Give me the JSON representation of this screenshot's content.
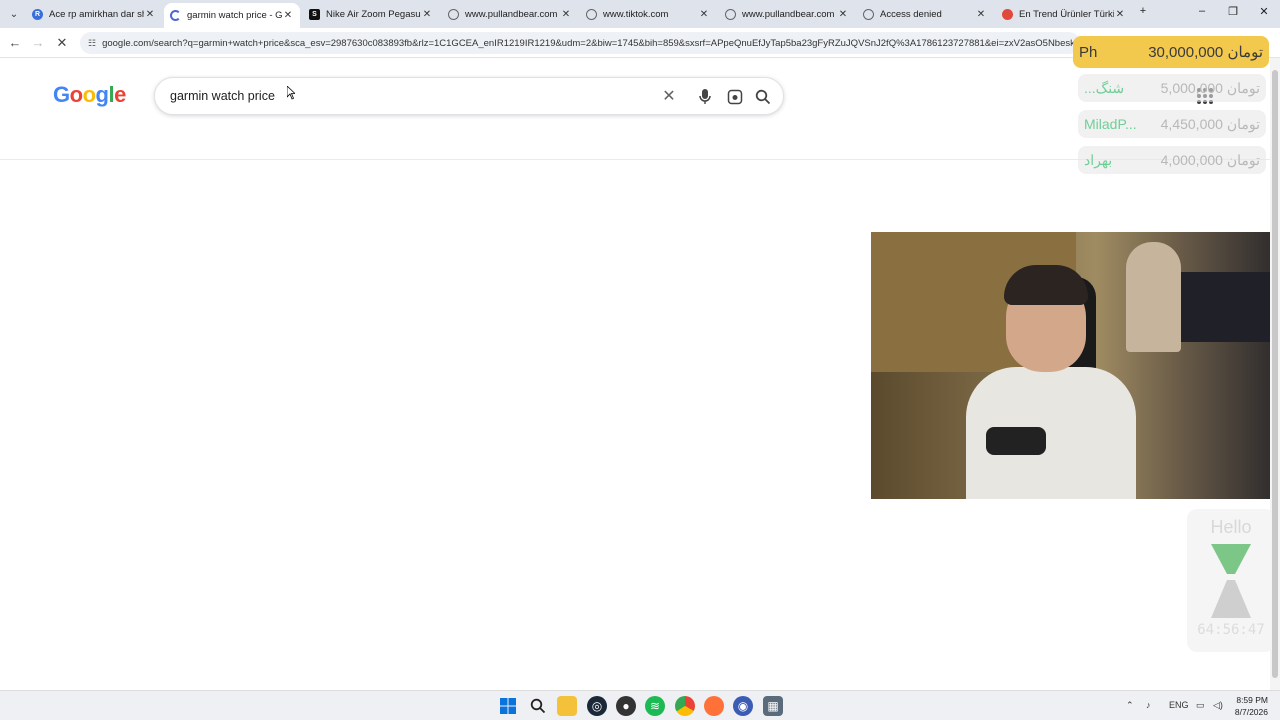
{
  "browser": {
    "tabs": [
      {
        "title": "Ace rp amirkhan dar shah",
        "favicon": "blue-circle-icon",
        "active": false
      },
      {
        "title": "garmin watch price - Goo",
        "favicon": "loading-icon",
        "active": true
      },
      {
        "title": "Nike Air Zoom Pegasus 3",
        "favicon": "s-square-icon",
        "active": false
      },
      {
        "title": "www.pullandbear.com",
        "favicon": "globe-icon",
        "active": false
      },
      {
        "title": "www.tiktok.com",
        "favicon": "globe-icon",
        "active": false
      },
      {
        "title": "www.pullandbear.com",
        "favicon": "globe-icon",
        "active": false
      },
      {
        "title": "Access denied",
        "favicon": "globe-icon",
        "active": false
      },
      {
        "title": "En Trend Ürünler Türkiye",
        "favicon": "red-circle-icon",
        "active": false
      }
    ],
    "url": "google.com/search?q=garmin+watch+price&sca_esv=2987630c083893fb&rlz=1C1GCEA_enIR1219IR1219&udm=2&biw=1745&bih=859&sxsrf=APpeQnuEfJyTap5ba23gFyRZuJQVSnJ2fQ%3A1786123727881&ei=zxV2asO5NbeskdUPyNi"
  },
  "google": {
    "logo": [
      "G",
      "o",
      "o",
      "g",
      "l",
      "e"
    ],
    "logo_colors": [
      "#4285f4",
      "#ea4335",
      "#fbbc05",
      "#4285f4",
      "#34a853",
      "#ea4335"
    ],
    "query": "garmin watch price"
  },
  "overlay": {
    "donations": [
      {
        "name": "Ph",
        "amount": "30,000,000 تومان"
      },
      {
        "name": "...شنگ",
        "amount": "5,000,000 تومان"
      },
      {
        "name": "MiladP...",
        "amount": "4,450,000 تومان"
      },
      {
        "name": "بهراد",
        "amount": "4,000,000 تومان"
      }
    ],
    "timer_label": "Hello",
    "timer_value": "64:56:47"
  },
  "taskbar": {
    "lang": "ENG",
    "time": "8:59 PM",
    "date": "8/7/2026"
  }
}
